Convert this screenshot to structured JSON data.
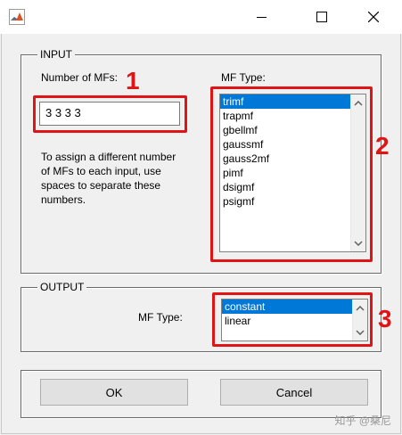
{
  "window": {
    "minimize_icon": "minimize-icon",
    "maximize_icon": "maximize-icon",
    "close_icon": "close-icon"
  },
  "input_panel": {
    "title": "INPUT",
    "num_mfs_label": "Number of MFs:",
    "num_mfs_value": "3 3 3 3",
    "description_lines": [
      "To assign a different number",
      "of MFs to each input, use",
      "spaces to separate these",
      "numbers."
    ],
    "mf_type_label": "MF Type:",
    "mf_types": [
      "trimf",
      "trapmf",
      "gbellmf",
      "gaussmf",
      "gauss2mf",
      "pimf",
      "dsigmf",
      "psigmf"
    ],
    "selected_mf_type": "trimf"
  },
  "output_panel": {
    "title": "OUTPUT",
    "mf_type_label": "MF Type:",
    "mf_types": [
      "constant",
      "linear"
    ],
    "selected_mf_type": "constant"
  },
  "buttons": {
    "ok": "OK",
    "cancel": "Cancel"
  },
  "annotations": {
    "badge1": "1",
    "badge2": "2",
    "badge3": "3",
    "color": "#e01414"
  },
  "watermark": "知乎 @桑尼",
  "colors": {
    "selection": "#0078d7",
    "annotation_red": "#e01414"
  }
}
